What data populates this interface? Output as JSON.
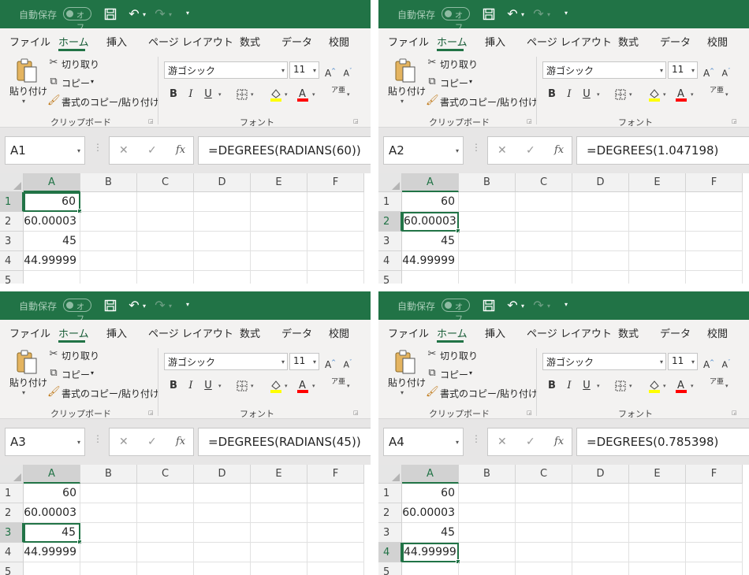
{
  "app": {
    "autosave_label": "自動保存",
    "autosave_state": "オフ",
    "icons": {
      "save": "save-icon",
      "undo": "undo-icon",
      "redo": "redo-icon",
      "customize": "customize-qat-icon"
    },
    "colors": {
      "brand": "#217346",
      "selection": "#217346",
      "highlight": "#ffff00",
      "font_color": "#ff0000"
    }
  },
  "ribbon": {
    "tabs": [
      "ファイル",
      "ホーム",
      "挿入",
      "ページ レイアウト",
      "数式",
      "データ",
      "校閲"
    ],
    "active_tab": "ホーム",
    "clipboard": {
      "paste": "貼り付け",
      "cut": "切り取り",
      "copy": "コピー",
      "format_painter": "書式のコピー/貼り付け",
      "group_label": "クリップボード"
    },
    "font": {
      "font_name": "游ゴシック",
      "font_size": "11",
      "bold": "B",
      "italic": "I",
      "underline": "U",
      "group_label": "フォント",
      "phonetic": "ア亜"
    }
  },
  "grid": {
    "columns": [
      "A",
      "B",
      "C",
      "D",
      "E",
      "F"
    ],
    "rows": [
      "1",
      "2",
      "3",
      "4",
      "5"
    ],
    "values": [
      "60",
      "60.00003",
      "45",
      "44.99999",
      ""
    ]
  },
  "panels": [
    {
      "name_box": "A1",
      "formula": "=DEGREES(RADIANS(60))",
      "selected_row": 1
    },
    {
      "name_box": "A2",
      "formula": "=DEGREES(1.047198)",
      "selected_row": 2
    },
    {
      "name_box": "A3",
      "formula": "=DEGREES(RADIANS(45))",
      "selected_row": 3
    },
    {
      "name_box": "A4",
      "formula": "=DEGREES(0.785398)",
      "selected_row": 4
    }
  ]
}
